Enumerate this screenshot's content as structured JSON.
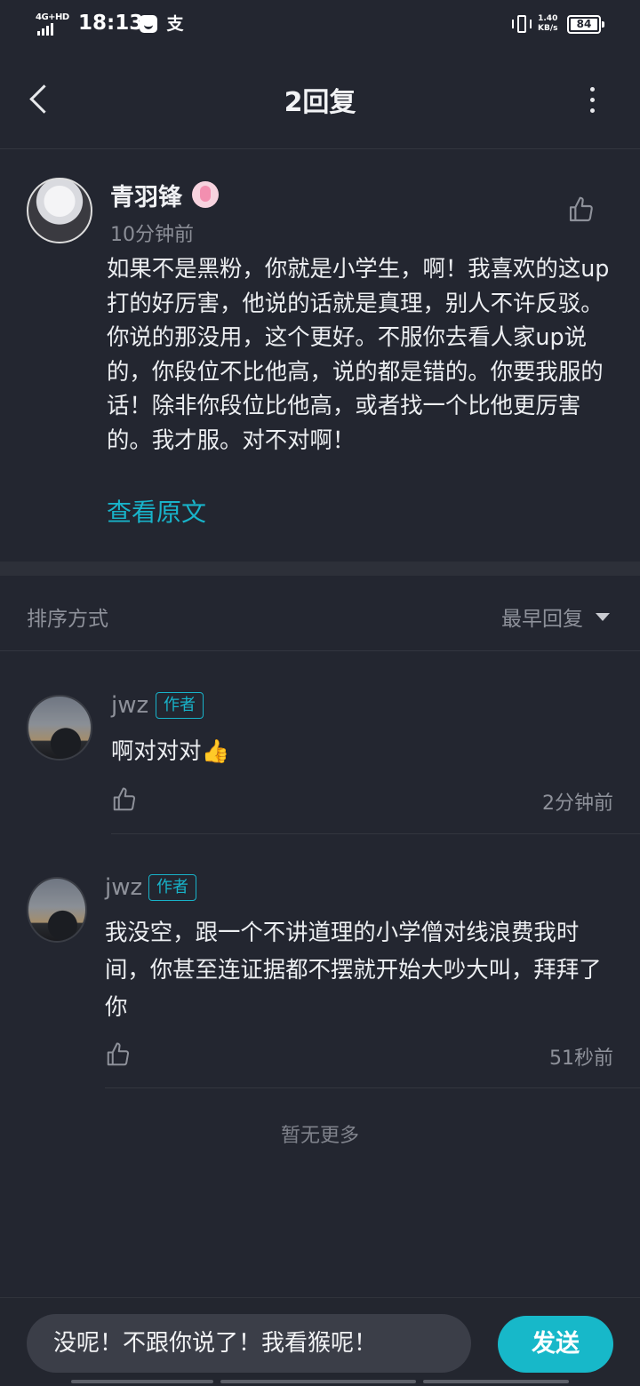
{
  "status_bar": {
    "network": "4G+HD",
    "time": "18:13",
    "app_icon_2": "支",
    "speed_value": "1.40",
    "speed_unit": "KB/s",
    "battery": "84"
  },
  "header": {
    "title": "2回复",
    "back_icon": "chevron-left-icon",
    "more_icon": "more-vertical-icon"
  },
  "root_comment": {
    "username": "青羽锋",
    "time": "10分钟前",
    "text": "如果不是黑粉，你就是小学生，啊！我喜欢的这up打的好厉害，他说的话就是真理，别人不许反驳。你说的那没用，这个更好。不服你去看人家up说的，你段位不比他高，说的都是错的。你要我服的话！除非你段位比他高，或者找一个比他更厉害的。我才服。对不对啊！",
    "view_original": "查看原文"
  },
  "sort": {
    "label": "排序方式",
    "selected": "最早回复"
  },
  "replies": [
    {
      "username": "jwz",
      "tag": "作者",
      "text": "啊对对对👍",
      "time": "2分钟前"
    },
    {
      "username": "jwz",
      "tag": "作者",
      "text": "我没空，跟一个不讲道理的小学僧对线浪费我时间，你甚至连证据都不摆就开始大吵大叫，拜拜了你",
      "time": "51秒前"
    }
  ],
  "no_more": "暂无更多",
  "composer": {
    "value": "没呢！不跟你说了！我看猴呢！",
    "send_label": "发送"
  },
  "colors": {
    "background": "#232630",
    "accent": "#17b8c9",
    "muted_text": "#8e919a"
  }
}
